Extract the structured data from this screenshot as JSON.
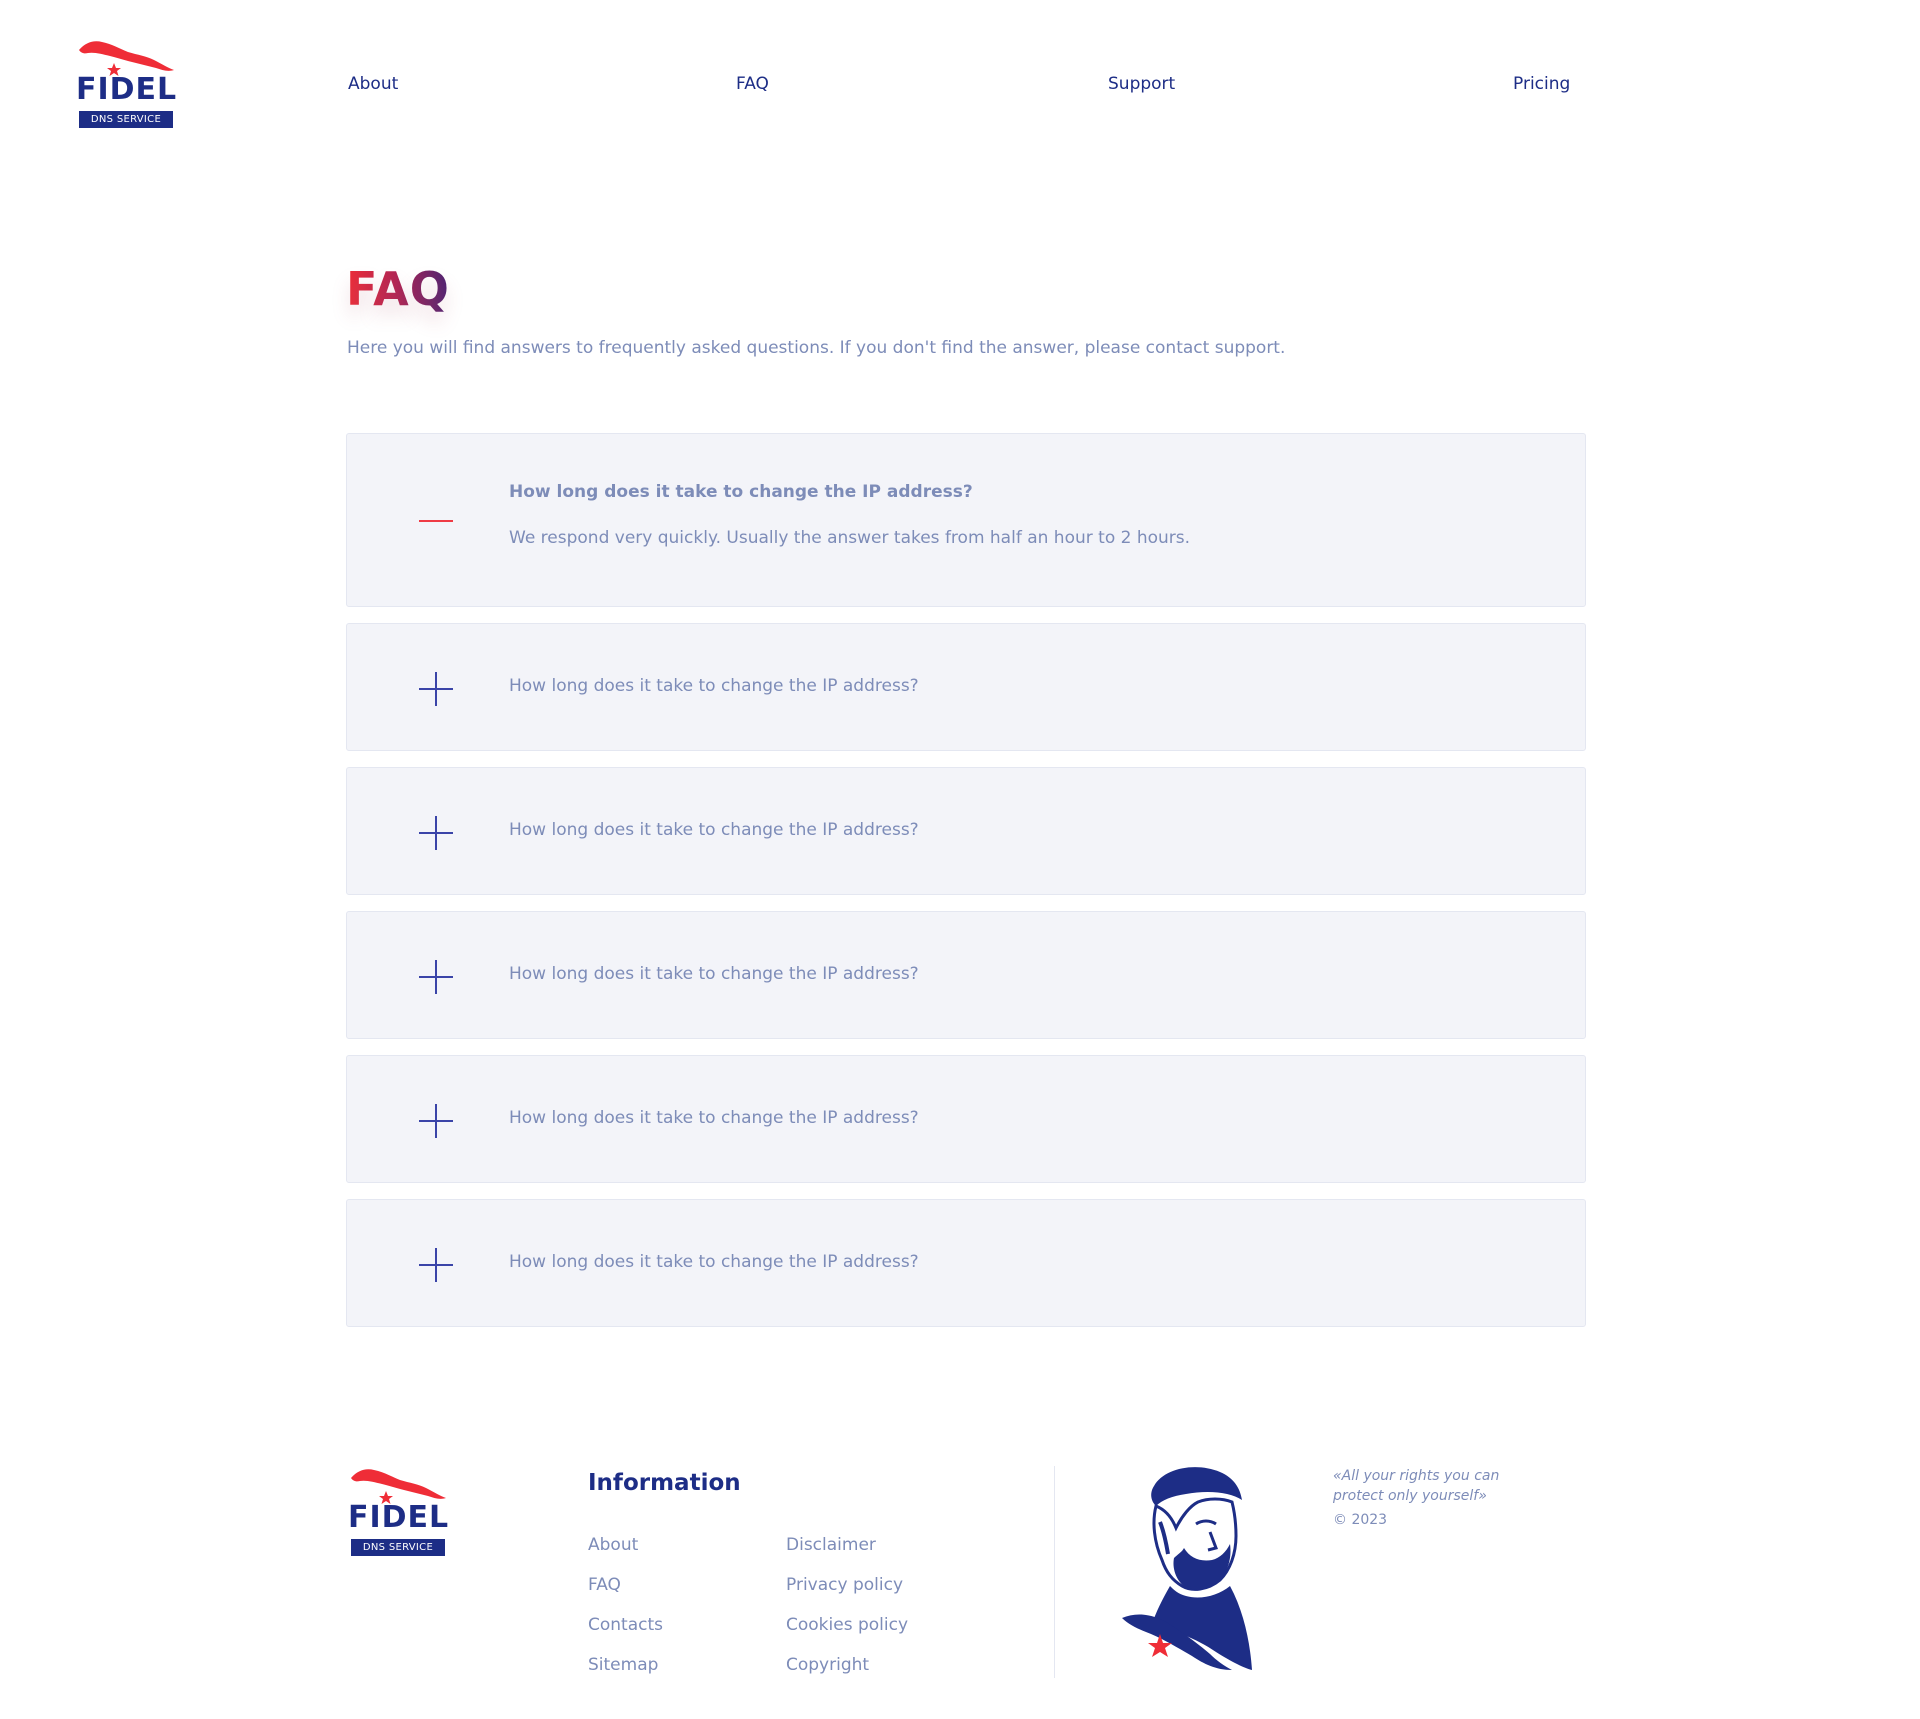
{
  "brand": {
    "name": "FIDEL",
    "tagline": "DNS SERVICE"
  },
  "nav": {
    "about": "About",
    "faq": "FAQ",
    "support": "Support",
    "pricing": "Pricing"
  },
  "intro": {
    "title": "FAQ",
    "subtitle": "Here you will find answers to frequently asked questions. If you don't find the answer, please contact support."
  },
  "faq": {
    "items": [
      {
        "question": "How long does it take to change the IP address?",
        "answer": "We respond very quickly. Usually the answer takes from half an hour to 2 hours.",
        "expanded": true
      },
      {
        "question": "How long does it take to change the IP address?",
        "expanded": false
      },
      {
        "question": "How long does it take to change the IP address?",
        "expanded": false
      },
      {
        "question": "How long does it take to change the IP address?",
        "expanded": false
      },
      {
        "question": "How long does it take to change the IP address?",
        "expanded": false
      },
      {
        "question": "How long does it take to change the IP address?",
        "expanded": false
      }
    ]
  },
  "footer": {
    "heading": "Information",
    "column1": [
      "About",
      "FAQ",
      "Contacts",
      "Sitemap"
    ],
    "column2": [
      "Disclaimer",
      "Privacy policy",
      "Cookies policy",
      "Copyright"
    ],
    "quote": "«All your rights you can protect only yourself»",
    "copyright": "© 2023"
  },
  "colors": {
    "brand_blue": "#1d2d86",
    "accent_red": "#ef2d37",
    "muted_text": "#7d8cb8",
    "card_bg": "#f3f4f9"
  },
  "icons": {
    "collapse": "minus-icon",
    "expand": "plus-icon",
    "logo_map": "cuba-map-icon",
    "portrait": "fidel-portrait-illustration"
  }
}
